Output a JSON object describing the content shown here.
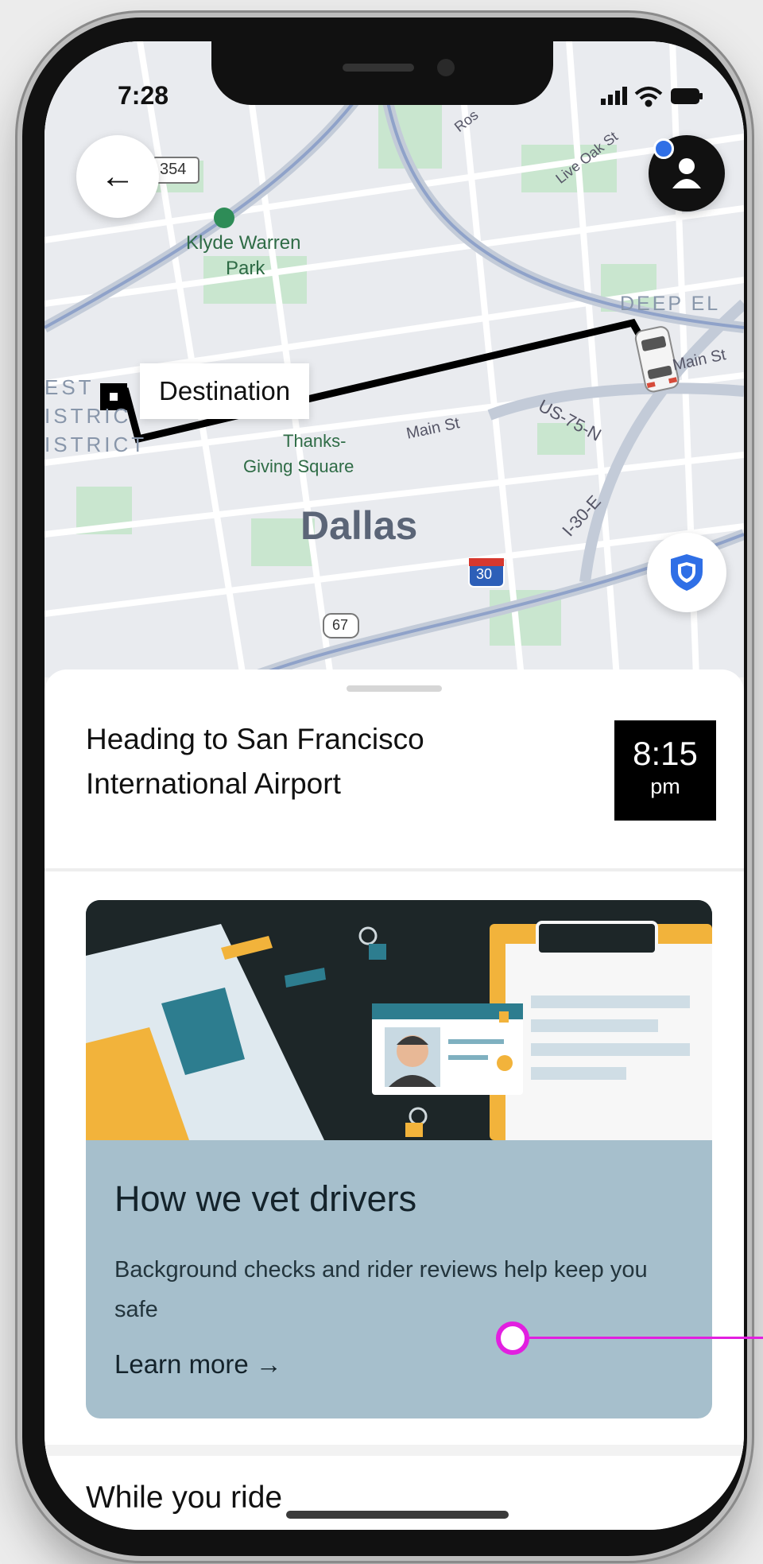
{
  "status_bar": {
    "time": "7:28"
  },
  "map": {
    "destination_label": "Destination",
    "city_label": "Dallas",
    "street_labels": [
      "Klyde Warren",
      "Park",
      "DEEP EL",
      "Main St",
      "Main St",
      "US-75-N",
      "I-30-E",
      "Thanks-",
      "Giving Square",
      "Live Oak St",
      "Ros"
    ],
    "district_labels": [
      "EST",
      "ISTRIC",
      "ISTRICT"
    ],
    "shield_labels": [
      "354",
      "30",
      "67"
    ]
  },
  "trip": {
    "heading_line1": "Heading to San Francisco",
    "heading_line2": "International Airport",
    "eta_time": "8:15",
    "eta_ampm": "pm"
  },
  "safety_card": {
    "title": "How we vet drivers",
    "body": "Background checks and rider reviews help keep you safe",
    "link": "Learn more →"
  },
  "section": {
    "title": "While you ride"
  },
  "icons": [
    "back-arrow-icon",
    "account-icon",
    "shield-icon",
    "signal-icon",
    "wifi-icon",
    "battery-icon"
  ],
  "colors": {
    "accent_blue": "#2f6fe6",
    "card_bg": "#a6bfcc",
    "route": "#000000",
    "eta_bg": "#000000",
    "highlight": "#e21fe0"
  }
}
